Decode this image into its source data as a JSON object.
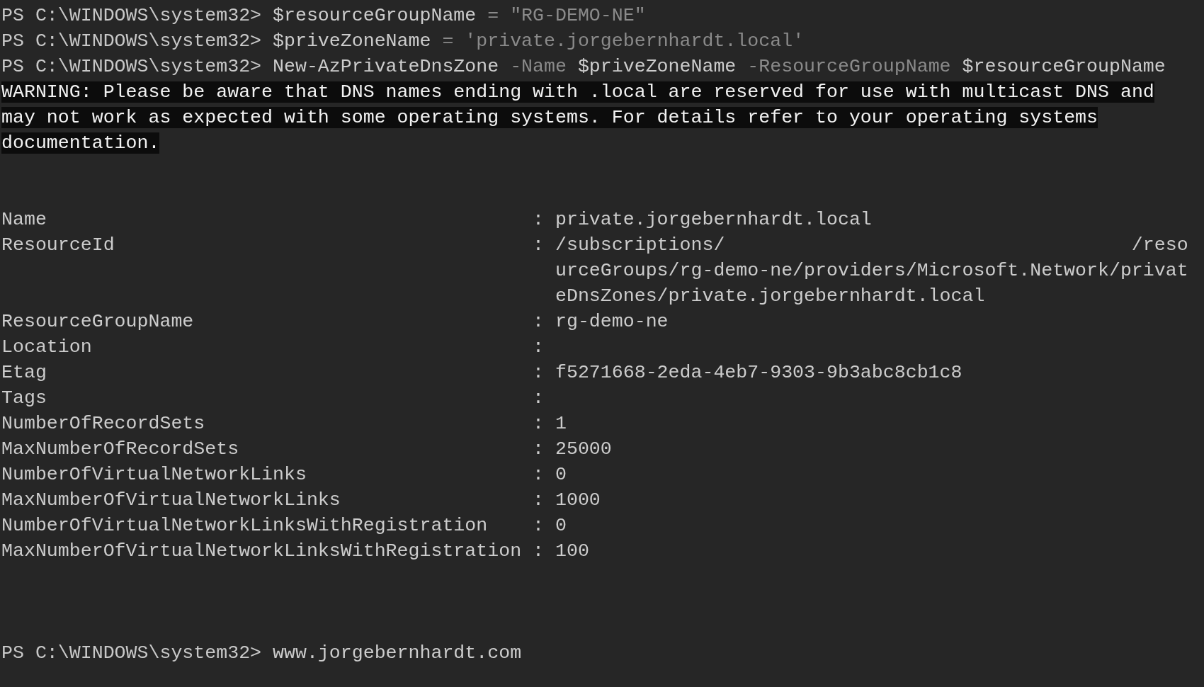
{
  "commands": [
    {
      "tokens": [
        {
          "kind": "prompt",
          "text": "PS C:\\WINDOWS\\system32>"
        },
        {
          "kind": "variable",
          "text": "$resourceGroupName"
        },
        {
          "kind": "operator",
          "text": "="
        },
        {
          "kind": "string",
          "text": "\"RG-DEMO-NE\""
        }
      ]
    },
    {
      "tokens": [
        {
          "kind": "prompt",
          "text": "PS C:\\WINDOWS\\system32>"
        },
        {
          "kind": "variable",
          "text": "$priveZoneName"
        },
        {
          "kind": "operator",
          "text": "="
        },
        {
          "kind": "string",
          "text": "'private.jorgebernhardt.local'"
        }
      ]
    },
    {
      "tokens": [
        {
          "kind": "prompt",
          "text": "PS C:\\WINDOWS\\system32>"
        },
        {
          "kind": "command",
          "text": "New-AzPrivateDnsZone"
        },
        {
          "kind": "parameter",
          "text": "-Name"
        },
        {
          "kind": "variable",
          "text": "$priveZoneName"
        },
        {
          "kind": "parameter",
          "text": "-ResourceGroupName"
        },
        {
          "kind": "variable",
          "text": "$resourceGroupName"
        }
      ]
    }
  ],
  "warning": {
    "lines": [
      "WARNING: Please be aware that DNS names ending with .local are reserved for use with multicast DNS and",
      "may not work as expected with some operating systems. For details refer to your operating systems",
      "documentation."
    ]
  },
  "properties": {
    "separator": ":",
    "items": [
      {
        "name": "Name",
        "value": [
          "private.jorgebernhardt.local"
        ]
      },
      {
        "name": "ResourceId",
        "value": [
          "/subscriptions/                                    /reso",
          "urceGroups/rg-demo-ne/providers/Microsoft.Network/privat",
          "eDnsZones/private.jorgebernhardt.local"
        ]
      },
      {
        "name": "ResourceGroupName",
        "value": [
          "rg-demo-ne"
        ]
      },
      {
        "name": "Location"
      },
      {
        "name": "Etag",
        "value": [
          "f5271668-2eda-4eb7-9303-9b3abc8cb1c8"
        ]
      },
      {
        "name": "Tags"
      },
      {
        "name": "NumberOfRecordSets",
        "value": [
          "1"
        ]
      },
      {
        "name": "MaxNumberOfRecordSets",
        "value": [
          "25000"
        ]
      },
      {
        "name": "NumberOfVirtualNetworkLinks",
        "value": [
          "0"
        ]
      },
      {
        "name": "MaxNumberOfVirtualNetworkLinks",
        "value": [
          "1000"
        ]
      },
      {
        "name": "NumberOfVirtualNetworkLinksWithRegistration",
        "value": [
          "0"
        ]
      },
      {
        "name": "MaxNumberOfVirtualNetworkLinksWithRegistration",
        "value": [
          "100"
        ]
      }
    ]
  },
  "final_prompt": {
    "prompt": "PS C:\\WINDOWS\\system32>",
    "input": "www.jorgebernhardt.com"
  }
}
